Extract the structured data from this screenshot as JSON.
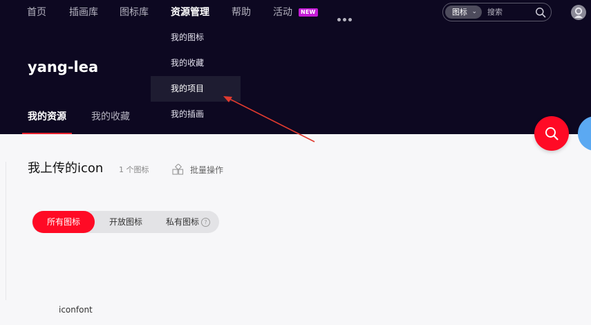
{
  "nav": {
    "items": [
      {
        "label": "首页"
      },
      {
        "label": "插画库"
      },
      {
        "label": "图标库"
      },
      {
        "label": "资源管理"
      },
      {
        "label": "帮助"
      },
      {
        "label": "活动"
      }
    ],
    "badge": "NEW",
    "active_index": 3
  },
  "search": {
    "type_label": "图标",
    "placeholder": "搜索"
  },
  "user": {
    "name": "yang-lea"
  },
  "sub_tabs": [
    {
      "label": "我的资源"
    },
    {
      "label": "我的收藏"
    }
  ],
  "dropdown": {
    "items": [
      {
        "label": "我的图标"
      },
      {
        "label": "我的收藏"
      },
      {
        "label": "我的项目"
      },
      {
        "label": "我的插画"
      }
    ],
    "highlighted_index": 2
  },
  "content": {
    "title": "我上传的icon",
    "count": "1 个图标",
    "batch_label": "批量操作",
    "filters": [
      {
        "label": "所有图标"
      },
      {
        "label": "开放图标"
      },
      {
        "label": "私有图标"
      }
    ],
    "active_filter_index": 0
  },
  "footer": {
    "brand": "iconfont"
  },
  "colors": {
    "header_bg": "#0d0821",
    "accent_red": "#ff0a25",
    "badge_purple": "#c41bd6",
    "annotation_arrow": "#e03a2f",
    "float_blue": "#5ba9f2"
  },
  "icons": {
    "search": "search-icon",
    "more": "more-icon",
    "avatar": "user-avatar-icon",
    "batch": "batch-operation-icon",
    "help": "help-icon"
  }
}
